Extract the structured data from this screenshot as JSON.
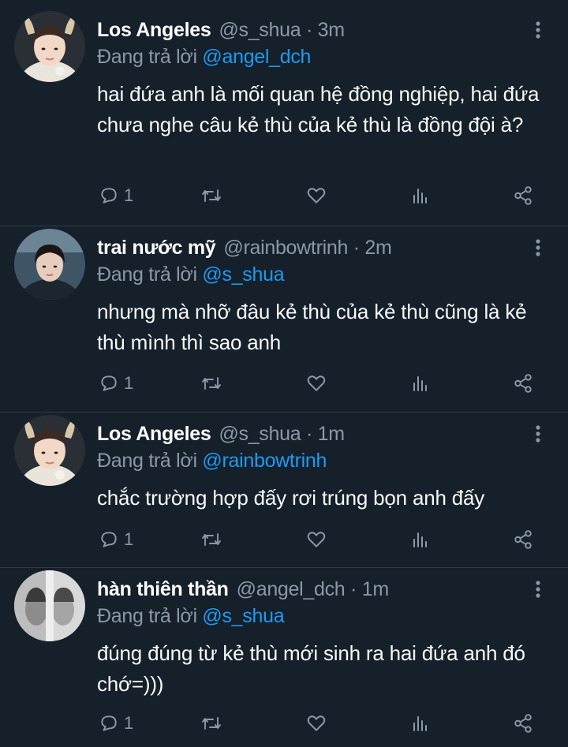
{
  "ui": {
    "reply_prefix": "Đang trả lời",
    "icons": [
      "reply-icon",
      "retweet-icon",
      "like-icon",
      "views-icon",
      "share-icon",
      "more-icon"
    ],
    "colors": {
      "background": "#15202b",
      "text": "#ffffff",
      "muted": "#8b98a5",
      "accent": "#1d9bf0"
    }
  },
  "tweets": [
    {
      "name": "Los Angeles",
      "meta": "@s_shua · 3m",
      "reply_to": "@angel_dch",
      "text": "hai đứa anh là mối quan hệ đồng nghiệp, hai đứa chưa nghe câu kẻ thù của kẻ thù là đồng đội à?",
      "reply_count": "1"
    },
    {
      "name": "trai nước mỹ",
      "meta": "@rainbowtrinh · 2m",
      "reply_to": "@s_shua",
      "text": "nhưng mà nhỡ đâu kẻ thù của kẻ thù cũng là kẻ thù mình thì sao anh",
      "reply_count": "1"
    },
    {
      "name": "Los Angeles",
      "meta": "@s_shua · 1m",
      "reply_to": "@rainbowtrinh",
      "text": "chắc trường hợp đấy rơi trúng bọn anh đấy",
      "reply_count": "1"
    },
    {
      "name": "hàn thiên thần",
      "meta": "@angel_dch · 1m",
      "reply_to": "@s_shua",
      "text": "đúng đúng từ kẻ thù mới sinh ra hai đứa anh đó chớ=)))",
      "reply_count": "1"
    }
  ]
}
